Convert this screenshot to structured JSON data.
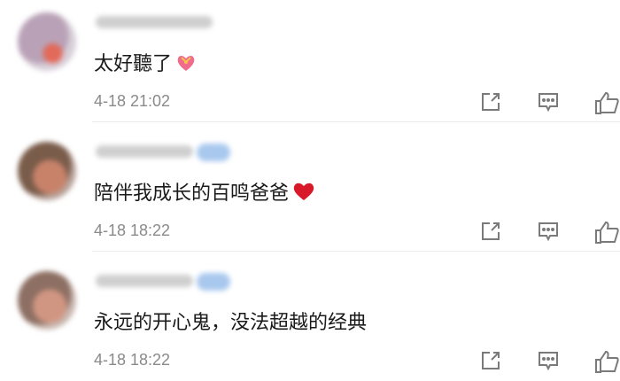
{
  "comments": [
    {
      "text": "太好聽了",
      "emoji": "heart-with-ribbon-icon",
      "time": "4-18 21:02",
      "has_vip": false
    },
    {
      "text": "陪伴我成长的百鸣爸爸",
      "emoji": "red-heart-icon",
      "time": "4-18 18:22",
      "has_vip": true
    },
    {
      "text": "永远的开心鬼，没法超越的经典",
      "emoji": "",
      "time": "4-18 18:22",
      "has_vip": true
    }
  ],
  "actions": [
    "share-icon",
    "comment-icon",
    "thumbs-up-icon"
  ],
  "colors": {
    "text": "#1a1a1a",
    "time": "#8a8a8a",
    "icon": "#7a7a7a",
    "heart": "#d7192a",
    "divider": "#ececec"
  }
}
